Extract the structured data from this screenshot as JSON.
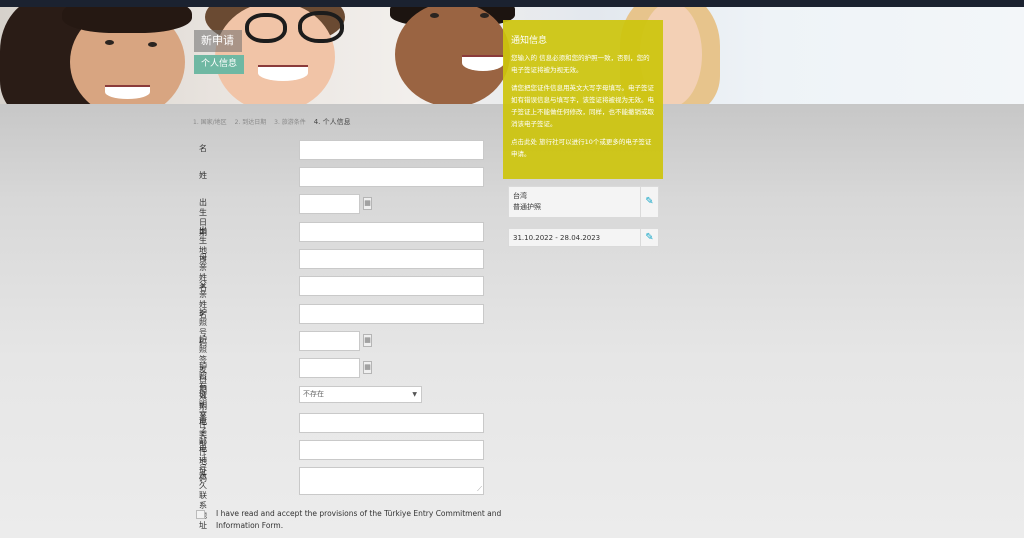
{
  "header": {
    "title": "新申请",
    "subtitle": "个人信息"
  },
  "steps": [
    "1. 国家/地区",
    "2. 到达日期",
    "3. 旅游条件",
    "4. 个人信息"
  ],
  "form": {
    "fields": [
      {
        "label": "名",
        "value": ""
      },
      {
        "label": "姓",
        "value": ""
      },
      {
        "label": "出生日期",
        "value": ""
      },
      {
        "label": "出生地点",
        "value": ""
      },
      {
        "label": "母亲姓名",
        "value": ""
      },
      {
        "label": "父亲姓名",
        "value": ""
      },
      {
        "label": "护照号码",
        "value": ""
      },
      {
        "label": "护照签发日期",
        "value": ""
      },
      {
        "label": "护照有效期至",
        "value": ""
      },
      {
        "label": "证明文件类型",
        "value": "不存在"
      },
      {
        "label": "电子邮件地址",
        "value": ""
      },
      {
        "label": "电话号码",
        "value": ""
      },
      {
        "label": "永久联系地址",
        "value": ""
      }
    ],
    "calendar_icon": "calendar-icon",
    "agree_text": "I have read and accept the provisions of the Türkiye Entry Commitment and Information Form."
  },
  "notice": {
    "title": "通知信息",
    "p1": "您输入的 信息必须和您的护照一致，否则，您的电子签证将被为视无效。",
    "p2": "请您把您证件信息用英文大写字母填写。电子签证如有错误信息与填写字，该签证将被视为无效。电子签证上不能做任何修改，同样，也不能撤销或取消该电子签证。",
    "p3": "点击此处 旅行社可以进行10个或更多的电子签证申请。"
  },
  "summary": {
    "country": "台湾",
    "passport_type": "普通护照",
    "date_range": "31.10.2022 - 28.04.2023",
    "edit_icon": "pencil-icon"
  },
  "colors": {
    "notice_bg": "#cdc40c",
    "hero_sub_bg": "#6fb8a3",
    "edit_icon": "#14a6c7"
  }
}
